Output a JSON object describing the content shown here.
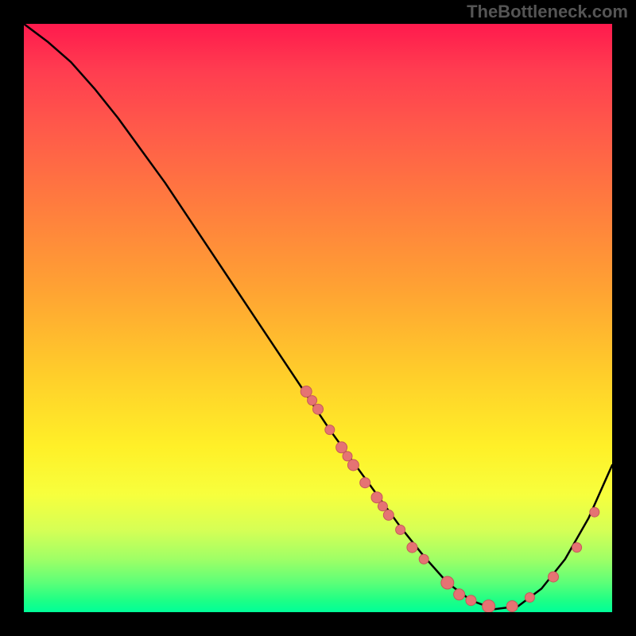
{
  "watermark": "TheBottleneck.com",
  "chart_data": {
    "type": "line",
    "title": "",
    "xlabel": "",
    "ylabel": "",
    "xlim": [
      0,
      100
    ],
    "ylim": [
      0,
      100
    ],
    "grid": false,
    "series": [
      {
        "name": "curve",
        "x": [
          0,
          4,
          8,
          12,
          16,
          20,
          24,
          28,
          32,
          36,
          40,
          44,
          48,
          52,
          56,
          60,
          64,
          68,
          72,
          76,
          80,
          84,
          88,
          92,
          96,
          100
        ],
        "y": [
          100,
          97,
          93.5,
          89,
          84,
          78.5,
          73,
          67,
          61,
          55,
          49,
          43,
          37,
          31,
          25.5,
          20,
          14.5,
          9.5,
          5,
          2,
          0.5,
          1,
          4,
          9,
          16,
          25
        ]
      }
    ],
    "points": [
      {
        "x": 48,
        "y": 37.5,
        "r": 7
      },
      {
        "x": 49,
        "y": 36,
        "r": 6
      },
      {
        "x": 50,
        "y": 34.5,
        "r": 6.5
      },
      {
        "x": 52,
        "y": 31,
        "r": 6
      },
      {
        "x": 54,
        "y": 28,
        "r": 7
      },
      {
        "x": 55,
        "y": 26.5,
        "r": 6
      },
      {
        "x": 56,
        "y": 25,
        "r": 7
      },
      {
        "x": 58,
        "y": 22,
        "r": 6.5
      },
      {
        "x": 60,
        "y": 19.5,
        "r": 7
      },
      {
        "x": 61,
        "y": 18,
        "r": 6
      },
      {
        "x": 62,
        "y": 16.5,
        "r": 6.5
      },
      {
        "x": 64,
        "y": 14,
        "r": 6
      },
      {
        "x": 66,
        "y": 11,
        "r": 6.5
      },
      {
        "x": 68,
        "y": 9,
        "r": 6
      },
      {
        "x": 72,
        "y": 5,
        "r": 8
      },
      {
        "x": 74,
        "y": 3,
        "r": 7
      },
      {
        "x": 76,
        "y": 2,
        "r": 6.5
      },
      {
        "x": 79,
        "y": 1,
        "r": 8
      },
      {
        "x": 83,
        "y": 1,
        "r": 7
      },
      {
        "x": 86,
        "y": 2.5,
        "r": 6
      },
      {
        "x": 90,
        "y": 6,
        "r": 6.5
      },
      {
        "x": 94,
        "y": 11,
        "r": 6
      },
      {
        "x": 97,
        "y": 17,
        "r": 6
      }
    ],
    "gradient_stops": [
      {
        "pos": 0,
        "color": "#ff1a4d"
      },
      {
        "pos": 8,
        "color": "#ff3d50"
      },
      {
        "pos": 18,
        "color": "#ff5a4a"
      },
      {
        "pos": 30,
        "color": "#ff7a3f"
      },
      {
        "pos": 45,
        "color": "#ffa233"
      },
      {
        "pos": 60,
        "color": "#ffcf2a"
      },
      {
        "pos": 72,
        "color": "#fff028"
      },
      {
        "pos": 80,
        "color": "#f7ff3d"
      },
      {
        "pos": 86,
        "color": "#d6ff55"
      },
      {
        "pos": 91,
        "color": "#9fff66"
      },
      {
        "pos": 95,
        "color": "#5cff78"
      },
      {
        "pos": 98,
        "color": "#1eff85"
      },
      {
        "pos": 100,
        "color": "#00ff99"
      }
    ],
    "colors": {
      "curve": "#000000",
      "point_fill": "#e57373",
      "point_stroke": "#c55a5a",
      "background": "#000000"
    }
  }
}
